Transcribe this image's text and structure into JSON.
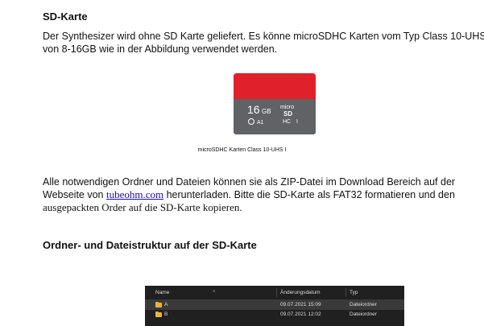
{
  "section1": {
    "heading": "SD-Karte",
    "para_line1": "Der Synthesizer wird ohne SD Karte geliefert. Es könne microSDHC Karten vom Typ Class 10-UHS",
    "para_line2": "von 8-16GB wie in der Abbildung verwendet werden."
  },
  "sd_card": {
    "capacity": "16",
    "unit": "GB",
    "brand_top": "micro",
    "brand_bottom": "SD",
    "hc": "HC",
    "uhs": "I",
    "class": "A1",
    "colors": {
      "top": "#e0202a",
      "bottom": "#606266"
    }
  },
  "image_caption": "microSDHC Karten Class 10-UHS I",
  "section2": {
    "line1": "Alle notwendigen Ordner und Dateien können sie als ZIP-Datei im Download Bereich auf der",
    "line2_pre": "Webseite von ",
    "line2_link": "tubeohm.com",
    "line2_post": " herunterladen. Bitte die SD-Karte als FAT32 formatieren und den",
    "line3": "ausgepackten Order auf die SD-Karte kopieren."
  },
  "section3": {
    "heading": "Ordner- und Dateistruktur auf der SD-Karte"
  },
  "explorer": {
    "columns": {
      "name": "Name",
      "date": "Änderungsdatum",
      "type": "Typ"
    },
    "rows": [
      {
        "name": "A",
        "date": "09.07.2021 15:09",
        "type": "Dateiordner"
      },
      {
        "name": "B",
        "date": "09.07.2021 12:02",
        "type": "Dateiordner"
      }
    ]
  }
}
